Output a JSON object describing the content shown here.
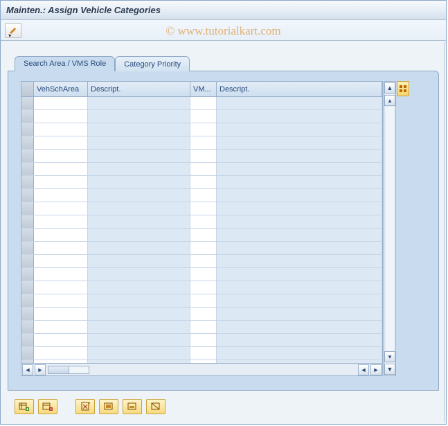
{
  "window": {
    "title": "Mainten.: Assign Vehicle Categories"
  },
  "watermark": "© www.tutorialkart.com",
  "toolbar": {
    "edit_tooltip": "Display/Change"
  },
  "tabs": [
    {
      "label": "Search Area / VMS Role",
      "active": true
    },
    {
      "label": "Category Priority",
      "active": false
    }
  ],
  "grid": {
    "columns": [
      {
        "key": "sel",
        "label": ""
      },
      {
        "key": "vehscharea",
        "label": "VehSchArea"
      },
      {
        "key": "descript1",
        "label": "Descript."
      },
      {
        "key": "vmsrole",
        "label": "VM..."
      },
      {
        "key": "descript2",
        "label": "Descript."
      }
    ],
    "row_count": 21,
    "config_tooltip": "Configuration"
  },
  "bottom_buttons": [
    {
      "name": "new-entries-button",
      "tooltip": "New Entries"
    },
    {
      "name": "copy-as-button",
      "tooltip": "Copy As..."
    },
    {
      "name": "delete-button",
      "tooltip": "Delete"
    },
    {
      "name": "select-all-button",
      "tooltip": "Select All"
    },
    {
      "name": "select-block-button",
      "tooltip": "Select Block"
    },
    {
      "name": "deselect-all-button",
      "tooltip": "Deselect All"
    }
  ]
}
